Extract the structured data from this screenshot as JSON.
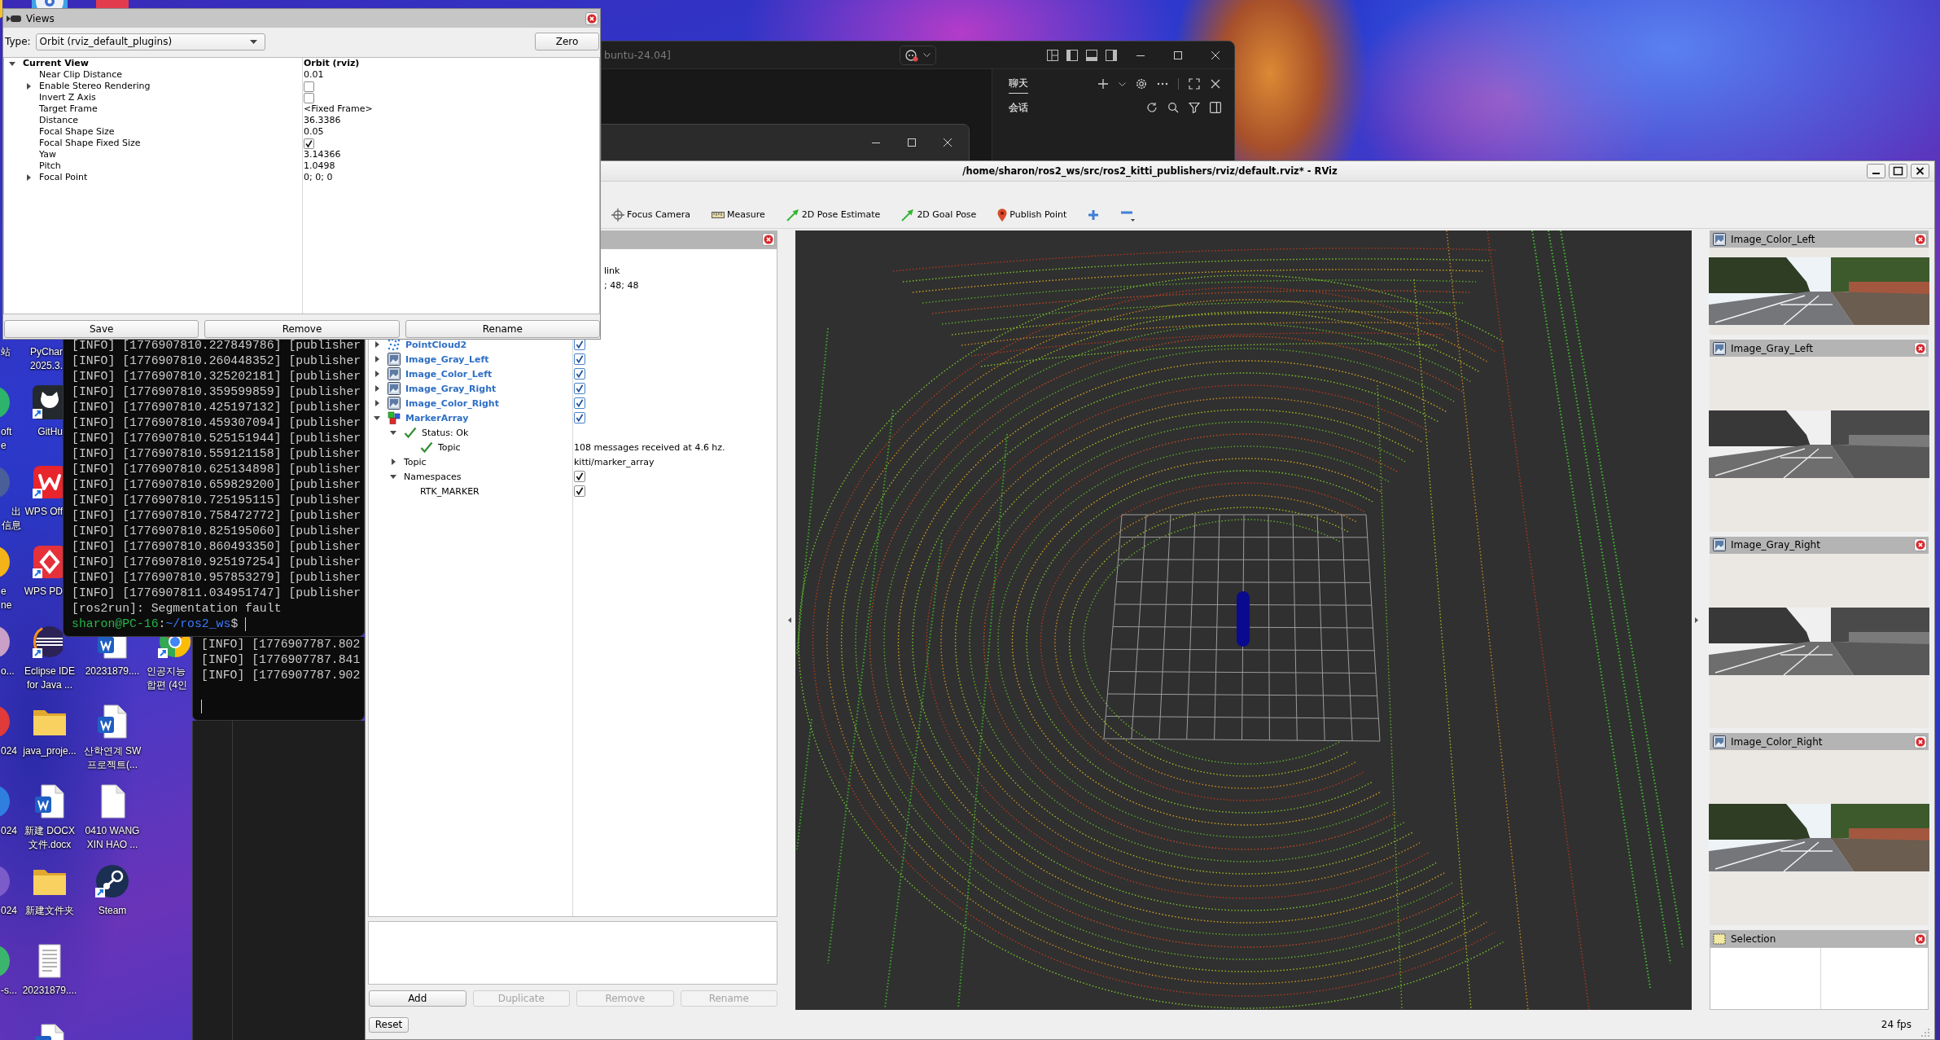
{
  "desktop": {
    "icons": [
      {
        "kind": "sliver"
      },
      {
        "kind": "disc"
      },
      {
        "kind": "redtile"
      },
      {
        "label": [
          "站"
        ]
      },
      {
        "label": [
          "PyChar",
          "2025.3."
        ]
      },
      {
        "kind": "sliver",
        "label": [
          "oft",
          "e"
        ]
      },
      {
        "kind": "cat",
        "label": [
          "GitHu"
        ]
      },
      {
        "kind": "sliver",
        "label": [
          "出",
          "信息"
        ]
      },
      {
        "kind": "wps",
        "label": [
          "WPS Off"
        ]
      },
      {
        "kind": "sliver",
        "label": [
          "e",
          "ne"
        ]
      },
      {
        "kind": "pdf",
        "label": [
          "WPS PD"
        ]
      },
      {
        "kind": "sliver",
        "label": [
          "o..."
        ]
      },
      {
        "kind": "eclipse",
        "label": [
          "Eclipse IDE",
          "for Java ..."
        ]
      },
      {
        "kind": "word",
        "label": [
          "20231879...."
        ]
      },
      {
        "kind": "chrome",
        "label": [
          "인공지능",
          "합편 (4인"
        ]
      },
      {
        "kind": "sliver",
        "label": [
          "024"
        ]
      },
      {
        "kind": "folder",
        "label": [
          "java_proje..."
        ]
      },
      {
        "kind": "word",
        "label": [
          "산학연계 SW",
          "프로젝트(..."
        ]
      },
      {
        "kind": "sliver",
        "label": [
          "024"
        ]
      },
      {
        "kind": "word",
        "label": [
          "新建 DOCX",
          "文件.docx"
        ]
      },
      {
        "kind": "file",
        "label": [
          "0410 WANG",
          "XIN HAO ..."
        ]
      },
      {
        "kind": "sliver",
        "label": [
          "024"
        ]
      },
      {
        "kind": "folder",
        "label": [
          "新建文件夹"
        ]
      },
      {
        "kind": "steam",
        "label": [
          "Steam"
        ]
      },
      {
        "kind": "sliver",
        "label": [
          "-s..."
        ]
      },
      {
        "kind": "text",
        "label": [
          "20231879...."
        ]
      },
      {
        "kind": "word"
      }
    ]
  },
  "views_panel": {
    "title": "Views",
    "type_label": "Type:",
    "type_value": "Orbit (rviz_default_plugins)",
    "zero_button": "Zero",
    "tree": [
      {
        "name": "Current View",
        "value": "Orbit (rviz)",
        "expanded": true,
        "children": [
          {
            "name": "Near Clip Distance",
            "value": "0.01"
          },
          {
            "name": "Enable Stereo Rendering",
            "expanded": false,
            "checked": false
          },
          {
            "name": "Invert Z Axis",
            "checked": false
          },
          {
            "name": "Target Frame",
            "value": "<Fixed Frame>"
          },
          {
            "name": "Distance",
            "value": "36.3386"
          },
          {
            "name": "Focal Shape Size",
            "value": "0.05"
          },
          {
            "name": "Focal Shape Fixed Size",
            "checked": true
          },
          {
            "name": "Yaw",
            "value": "3.14366"
          },
          {
            "name": "Pitch",
            "value": "1.0498"
          },
          {
            "name": "Focal Point",
            "expanded": false,
            "value": "0; 0; 0"
          }
        ]
      }
    ],
    "buttons": [
      "Save",
      "Remove",
      "Rename"
    ]
  },
  "wsl_window": {
    "title": "buntu-24.04]",
    "chat_tabs": [
      {
        "label": "聊天",
        "selected": true
      }
    ],
    "section_label": "会话"
  },
  "terminal": {
    "lines": [
      "[INFO] [1776907810.227849786] [publisher",
      "[INFO] [1776907810.260448352] [publisher",
      "[INFO] [1776907810.325202181] [publisher",
      "[INFO] [1776907810.359599859] [publisher",
      "[INFO] [1776907810.425197132] [publisher",
      "[INFO] [1776907810.459307094] [publisher",
      "[INFO] [1776907810.525151944] [publisher",
      "[INFO] [1776907810.559121158] [publisher",
      "[INFO] [1776907810.625134898] [publisher",
      "[INFO] [1776907810.659829200] [publisher",
      "[INFO] [1776907810.725195115] [publisher",
      "[INFO] [1776907810.758472772] [publisher",
      "[INFO] [1776907810.825195060] [publisher",
      "[INFO] [1776907810.860493350] [publisher",
      "[INFO] [1776907810.925197254] [publisher",
      "[INFO] [1776907810.957853279] [publisher",
      "[INFO] [1776907811.034951747] [publisher",
      "[ros2run]: Segmentation fault"
    ],
    "prompt": {
      "user": "sharon@PC-16",
      "separator": ":",
      "path": "~/ros2_ws",
      "symbol": "$"
    }
  },
  "background_terminal": {
    "lines": [
      "[INFO] [1776907787.802",
      "[INFO] [1776907787.841",
      "[INFO] [1776907787.902"
    ]
  },
  "rviz": {
    "title": "/home/sharon/ros2_ws/src/ros2_kitti_publishers/rviz/default.rviz* - RViz",
    "toolbar": [
      {
        "kind": "focus",
        "label": "Focus Camera"
      },
      {
        "kind": "measure",
        "label": "Measure"
      },
      {
        "kind": "pose",
        "label": "2D Pose Estimate"
      },
      {
        "kind": "pose",
        "label": "2D Goal Pose"
      },
      {
        "kind": "pin",
        "label": "Publish Point"
      },
      {
        "kind": "add"
      },
      {
        "kind": "remove"
      }
    ],
    "displays": {
      "partial_values": [
        "link",
        "; 48; 48"
      ],
      "tree": [
        {
          "name": "PointCloud2",
          "kind": "pointcloud",
          "expanded": false,
          "checked": true
        },
        {
          "name": "Image_Gray_Left",
          "kind": "image",
          "expanded": false,
          "checked": true
        },
        {
          "name": "Image_Color_Left",
          "kind": "image",
          "expanded": false,
          "checked": true
        },
        {
          "name": "Image_Gray_Right",
          "kind": "image",
          "expanded": false,
          "checked": true
        },
        {
          "name": "Image_Color_Right",
          "kind": "image",
          "expanded": false,
          "checked": true
        },
        {
          "name": "MarkerArray",
          "kind": "marker",
          "expanded": true,
          "checked": true,
          "children": [
            {
              "name": "Status: Ok",
              "kind": "status",
              "expanded": true,
              "children": [
                {
                  "name": "Topic",
                  "kind": "status",
                  "value": "108 messages received at 4.6 hz."
                }
              ]
            },
            {
              "name": "Topic",
              "kind": "property",
              "expanded": false,
              "value": "kitti/marker_array"
            },
            {
              "name": "Namespaces",
              "kind": "property",
              "expanded": true,
              "checked": true,
              "children": [
                {
                  "name": "RTK_MARKER",
                  "kind": "property",
                  "checked": true
                }
              ]
            }
          ]
        }
      ],
      "buttons": [
        {
          "label": "Add",
          "disabled": false
        },
        {
          "label": "Duplicate",
          "disabled": true
        },
        {
          "label": "Remove",
          "disabled": true
        },
        {
          "label": "Rename",
          "disabled": true
        }
      ]
    },
    "image_panels": [
      {
        "title": "Image_Color_Left",
        "kind": "color"
      },
      {
        "title": "Image_Gray_Left",
        "kind": "gray"
      },
      {
        "title": "Image_Gray_Right",
        "kind": "gray"
      },
      {
        "title": "Image_Color_Right",
        "kind": "color"
      }
    ],
    "selection_panel": {
      "title": "Selection"
    },
    "status_bar": {
      "reset_button": "Reset",
      "fps": "24 fps"
    }
  }
}
